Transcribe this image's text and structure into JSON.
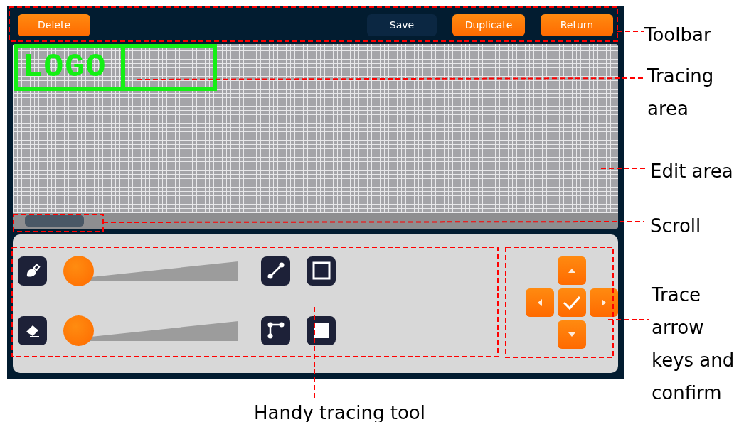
{
  "toolbar": {
    "buttons": [
      {
        "label": "Delete",
        "kind": "action"
      },
      {
        "label": "Save",
        "kind": "dark"
      },
      {
        "label": "Duplicate",
        "kind": "action"
      },
      {
        "label": "Return",
        "kind": "action"
      }
    ]
  },
  "edit_area": {
    "logo_text": "LOGO"
  },
  "tools": [
    {
      "kind": "brush",
      "level": 0
    },
    {
      "kind": "eraser",
      "level": 0
    }
  ],
  "callouts": [
    {
      "text": "Toolbar"
    },
    {
      "text": "Tracing area"
    },
    {
      "text": "Edit area"
    },
    {
      "text": "Scroll"
    },
    {
      "text": "Trace arrow keys and confirm"
    },
    {
      "text": "Handy tracing tool"
    }
  ]
}
